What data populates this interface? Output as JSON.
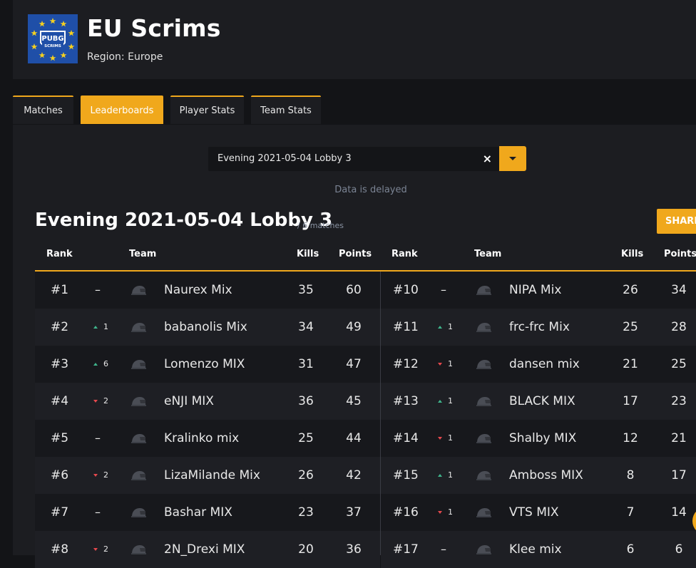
{
  "header": {
    "title": "EU Scrims",
    "region": "Region: Europe",
    "logo_text_top": "PUBG",
    "logo_text_bottom": "SCRIMS"
  },
  "tabs": [
    {
      "label": "Matches",
      "active": false
    },
    {
      "label": "Leaderboards",
      "active": true
    },
    {
      "label": "Player Stats",
      "active": false
    },
    {
      "label": "Team Stats",
      "active": false
    }
  ],
  "lobby_select": {
    "value": "Evening 2021-05-04 Lobby 3",
    "clear_icon": "×"
  },
  "delay_note": "Data is delayed",
  "leaderboard": {
    "title": "Evening 2021-05-04 Lobby 3",
    "subtitle": "/ 6 matches",
    "share_label": "SHARE",
    "columns": {
      "rank": "Rank",
      "team": "Team",
      "kills": "Kills",
      "points": "Points"
    },
    "left_rows": [
      {
        "rank": "#1",
        "change_dir": "none",
        "change": "–",
        "team": "Naurex Mix",
        "kills": "35",
        "points": "60"
      },
      {
        "rank": "#2",
        "change_dir": "up",
        "change": "1",
        "team": "babanolis Mix",
        "kills": "34",
        "points": "49"
      },
      {
        "rank": "#3",
        "change_dir": "up",
        "change": "6",
        "team": "Lomenzo MIX",
        "kills": "31",
        "points": "47"
      },
      {
        "rank": "#4",
        "change_dir": "down",
        "change": "2",
        "team": "eNJI MIX",
        "kills": "36",
        "points": "45"
      },
      {
        "rank": "#5",
        "change_dir": "none",
        "change": "–",
        "team": "Kralinko mix",
        "kills": "25",
        "points": "44"
      },
      {
        "rank": "#6",
        "change_dir": "down",
        "change": "2",
        "team": "LizaMilande Mix",
        "kills": "26",
        "points": "42"
      },
      {
        "rank": "#7",
        "change_dir": "none",
        "change": "–",
        "team": "Bashar MIX",
        "kills": "23",
        "points": "37"
      },
      {
        "rank": "#8",
        "change_dir": "down",
        "change": "2",
        "team": "2N_Drexi MIX",
        "kills": "20",
        "points": "36"
      }
    ],
    "right_rows": [
      {
        "rank": "#10",
        "change_dir": "none",
        "change": "–",
        "team": "NIPA Mix",
        "kills": "26",
        "points": "34"
      },
      {
        "rank": "#11",
        "change_dir": "up",
        "change": "1",
        "team": "frc-frc Mix",
        "kills": "25",
        "points": "28"
      },
      {
        "rank": "#12",
        "change_dir": "down",
        "change": "1",
        "team": "dansen mix",
        "kills": "21",
        "points": "25"
      },
      {
        "rank": "#13",
        "change_dir": "up",
        "change": "1",
        "team": "BLACK MIX",
        "kills": "17",
        "points": "23"
      },
      {
        "rank": "#14",
        "change_dir": "down",
        "change": "1",
        "team": "Shalby MIX",
        "kills": "12",
        "points": "21"
      },
      {
        "rank": "#15",
        "change_dir": "up",
        "change": "1",
        "team": "Amboss MIX",
        "kills": "8",
        "points": "17"
      },
      {
        "rank": "#16",
        "change_dir": "down",
        "change": "1",
        "team": "VTS MIX",
        "kills": "7",
        "points": "14"
      },
      {
        "rank": "#17",
        "change_dir": "none",
        "change": "–",
        "team": "Klee mix",
        "kills": "6",
        "points": "6"
      }
    ]
  },
  "colors": {
    "accent": "#f0a81c",
    "up": "#3fb58c",
    "down": "#e5484d",
    "background": "#131417",
    "panel": "#1c1d21"
  }
}
